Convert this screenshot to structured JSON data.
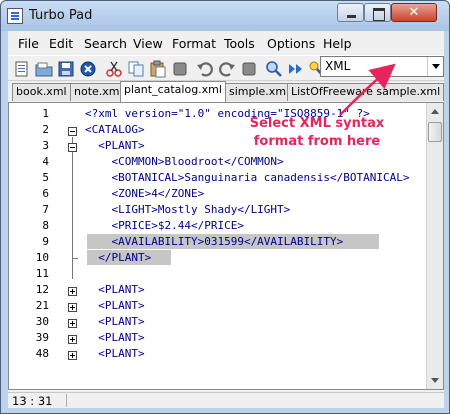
{
  "window": {
    "title": "Turbo Pad"
  },
  "menu": [
    "File",
    "Edit",
    "Search",
    "View",
    "Format",
    "Tools",
    "Options",
    "Help"
  ],
  "syntax_combo": {
    "value": "XML"
  },
  "tabs": [
    "book.xml",
    "note.xml",
    "plant_catalog.xml",
    "simple.xml",
    "ListOfFreeware sample.xml"
  ],
  "active_tab": "plant_catalog.xml",
  "editor": {
    "line_numbers": [
      "1",
      "2",
      "3",
      "4",
      "5",
      "6",
      "7",
      "8",
      "9",
      "10",
      "11",
      "12",
      "21",
      "30",
      "39",
      "48"
    ],
    "lines": [
      "<?xml version=\"1.0\" encoding=\"ISO8859-1\" ?>",
      "<CATALOG>",
      "  <PLANT>",
      "    <COMMON>Bloodroot</COMMON>",
      "    <BOTANICAL>Sanguinaria canadensis</BOTANICAL>",
      "    <ZONE>4</ZONE>",
      "    <LIGHT>Mostly Shady</LIGHT>",
      "    <PRICE>$2.44</PRICE>",
      "    <AVAILABILITY>031599</AVAILABILITY>",
      "  </PLANT>",
      "",
      "  <PLANT>",
      "  <PLANT>",
      "  <PLANT>",
      "  <PLANT>",
      "  <PLANT>"
    ]
  },
  "annotation": {
    "line1": "Select XML syntax",
    "line2": "format from here",
    "color": "#e8245f"
  },
  "status": {
    "position": "13 : 31"
  }
}
